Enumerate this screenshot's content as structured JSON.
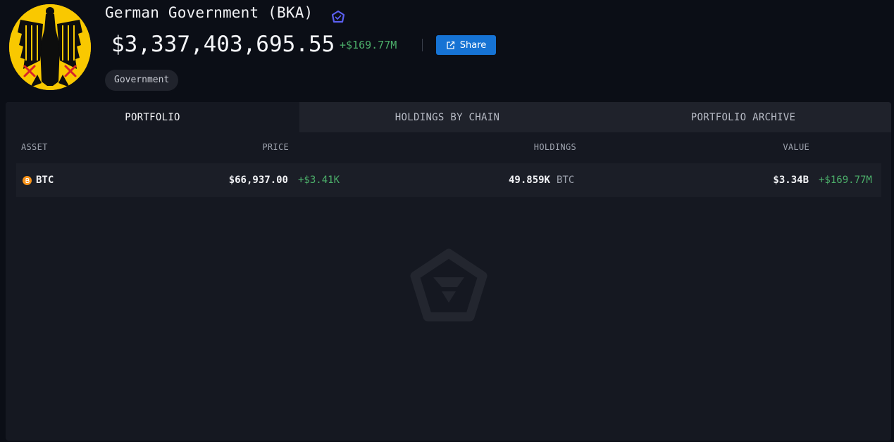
{
  "entity": {
    "name": "German Government (BKA)",
    "balance": "$3,337,403,695.55",
    "balance_change": "+$169.77M",
    "share_label": "Share",
    "tag": "Government"
  },
  "tabs": [
    {
      "label": "PORTFOLIO",
      "active": true
    },
    {
      "label": "HOLDINGS BY CHAIN",
      "active": false
    },
    {
      "label": "PORTFOLIO ARCHIVE",
      "active": false
    }
  ],
  "table": {
    "columns": {
      "asset": "ASSET",
      "price": "PRICE",
      "holdings": "HOLDINGS",
      "value": "VALUE"
    },
    "rows": [
      {
        "asset": "BTC",
        "icon": "bitcoin-icon",
        "price": "$66,937.00",
        "price_change": "+$3.41K",
        "holdings": "49.859K",
        "holdings_unit": "BTC",
        "value": "$3.34B",
        "value_change": "+$169.77M"
      }
    ]
  },
  "colors": {
    "background": "#0b0e16",
    "panel": "#151821",
    "accent": "#1673d4",
    "positive": "#4caf6a",
    "verified": "#5b5ff0",
    "bitcoin": "#f7931a"
  }
}
